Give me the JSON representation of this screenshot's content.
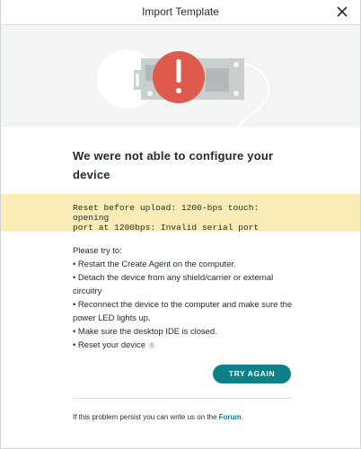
{
  "dialog": {
    "title": "Import Template",
    "close_icon": "close-icon"
  },
  "hero": {
    "illustration": "board-error-illustration",
    "colors": {
      "alert": "#dd5a4c",
      "board": "#c9cecf",
      "background": "#f3f4f4"
    }
  },
  "headline": {
    "line1": "We were not able to configure your",
    "line2": "device"
  },
  "error": {
    "line1": "Reset before upload: 1200-bps touch: opening",
    "line2": "port at 1200bps: Invalid serial port",
    "background": "#faecb6"
  },
  "tips": {
    "intro": "Please try to:",
    "items": [
      "• Restart the Create Agent on the computer.",
      "• Detach the device from any shield/carrier or external",
      "circuitry",
      "• Reconnect the device to the computer and make sure the",
      "power LED lights up.",
      "• Make sure the desktop IDE is closed.",
      "• Reset your device"
    ],
    "info_icon": "info-icon"
  },
  "actions": {
    "try_again_label": "TRY AGAIN",
    "accent": "#0e8188"
  },
  "footer": {
    "text": "If this problem persist you can write us on the ",
    "link_label": "Forum",
    "suffix": "."
  }
}
